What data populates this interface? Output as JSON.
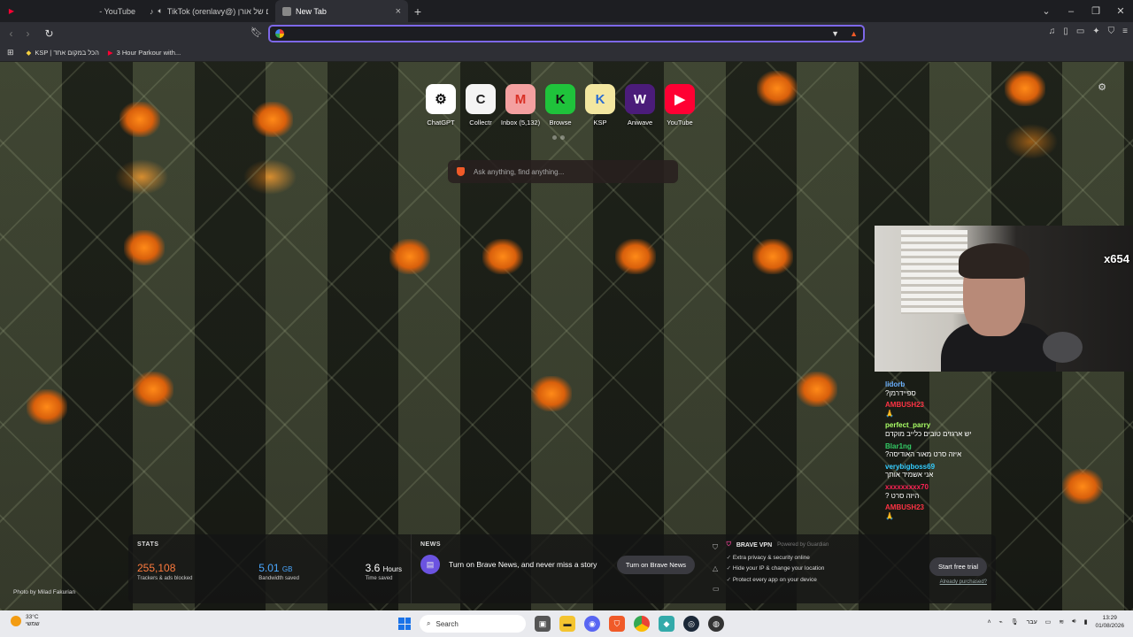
{
  "tabs": [
    {
      "label": "- YouTube",
      "icon": "youtube-icon",
      "color": "#ff0033"
    },
    {
      "label": "TikTok (orenlavy@) העולם של אורן",
      "icon": "tiktok-icon",
      "color": "#ffffff"
    },
    {
      "label": "New Tab",
      "icon": "newtab-icon",
      "color": "#aaaaaa"
    }
  ],
  "new_tab_symbol": "+",
  "close_symbol": "×",
  "window": {
    "minimize": "–",
    "maximize": "❐",
    "close": "✕",
    "chevron": "⌄"
  },
  "omnibox": {
    "value": "",
    "placeholder": ""
  },
  "bookmarks": [
    {
      "label": "KSP | הכל במקום אחד",
      "icon": "ksp-icon"
    },
    {
      "label": "3 Hour Parkour with...",
      "icon": "youtube-icon"
    }
  ],
  "top_sites": [
    {
      "label": "ChatGPT",
      "glyph": "⚙",
      "bg": "#ffffff",
      "fg": "#111111"
    },
    {
      "label": "Collectr",
      "glyph": "C",
      "bg": "#f4f4f4",
      "fg": "#222222"
    },
    {
      "label": "Inbox (5,132)",
      "glyph": "M",
      "bg": "#f4a0a0",
      "fg": "#d93025"
    },
    {
      "label": "Browse",
      "glyph": "K",
      "bg": "#1fc33b",
      "fg": "#111111"
    },
    {
      "label": "KSP",
      "glyph": "K",
      "bg": "#f3e7a0",
      "fg": "#2a6bd1"
    },
    {
      "label": "Aniwave",
      "glyph": "W",
      "bg": "#4b1c7a",
      "fg": "#ffffff"
    },
    {
      "label": "YouTube",
      "glyph": "▶",
      "bg": "#ff0033",
      "fg": "#ffffff"
    }
  ],
  "search": {
    "placeholder": "Ask anything, find anything..."
  },
  "webcam": {
    "badge": "x654"
  },
  "chat": [
    {
      "user": "lidorb",
      "color": "#6ab0ff",
      "text": "ספיידרמן?"
    },
    {
      "user": "AMBUSH23",
      "color": "#ff3344",
      "text": "🙏"
    },
    {
      "user": "perfect_parry",
      "color": "#aaff66",
      "text": "יש ארגזים טובים כלייב מוקדם"
    },
    {
      "user": "Blar1ng",
      "color": "#33cc66",
      "text": "איזה סרט מאור האודיסה?"
    },
    {
      "user": "verybigboss69",
      "color": "#33ccff",
      "text": "אני אשמיד אותך"
    },
    {
      "user": "xxxxxxxxx70",
      "color": "#ff2255",
      "text": "היזה סרט ?"
    },
    {
      "user": "AMBUSH23",
      "color": "#ff3344",
      "text": "🙏"
    }
  ],
  "stats": {
    "label": "STATS",
    "items": [
      {
        "value": "255,108",
        "unit": "",
        "sub": "Trackers & ads blocked",
        "color": "#ff7a3d"
      },
      {
        "value": "5.01",
        "unit": "GB",
        "sub": "Bandwidth saved",
        "color": "#4aa8ff"
      },
      {
        "value": "3.6",
        "unit": "Hours",
        "sub": "Time saved",
        "color": "#ffffff"
      }
    ]
  },
  "news": {
    "label": "NEWS",
    "text": "Turn on Brave News, and never miss a story",
    "button": "Turn on Brave News"
  },
  "vpn": {
    "title": "BRAVE VPN",
    "powered": "Powered by Guardian",
    "features": [
      "Extra privacy & security online",
      "Hide your IP & change your location",
      "Protect every app on your device"
    ],
    "button": "Start free trial",
    "link": "Already purchased?"
  },
  "photo_credit": "Photo by Milad Fakurian",
  "taskbar": {
    "weather_temp": "33°C",
    "weather_desc": "שמשי",
    "search": "Search",
    "lang": "עבר",
    "time": "13:29",
    "date": "01/08/2026"
  }
}
